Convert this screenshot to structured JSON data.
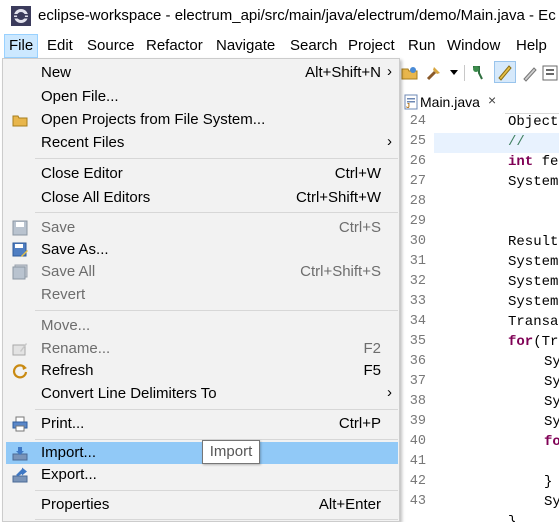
{
  "window": {
    "title": "eclipse-workspace - electrum_api/src/main/java/electrum/demo/Main.java - Ec"
  },
  "menubar": {
    "items": [
      {
        "label": "File"
      },
      {
        "label": "Edit"
      },
      {
        "label": "Source"
      },
      {
        "label": "Refactor"
      },
      {
        "label": "Navigate"
      },
      {
        "label": "Search"
      },
      {
        "label": "Project"
      },
      {
        "label": "Run"
      },
      {
        "label": "Window"
      },
      {
        "label": "Help"
      }
    ]
  },
  "file_menu": {
    "items": [
      {
        "label": "New",
        "shortcut": "Alt+Shift+N",
        "submenu": true
      },
      {
        "label": "Open File...",
        "shortcut": ""
      },
      {
        "label": "Open Projects from File System...",
        "shortcut": "",
        "icon": "folder-icon"
      },
      {
        "label": "Recent Files",
        "shortcut": "",
        "submenu": true
      },
      {
        "label": "Close Editor",
        "shortcut": "Ctrl+W"
      },
      {
        "label": "Close All Editors",
        "shortcut": "Ctrl+Shift+W"
      },
      {
        "label": "Save",
        "shortcut": "Ctrl+S",
        "disabled": true,
        "icon": "save-icon"
      },
      {
        "label": "Save As...",
        "shortcut": "",
        "icon": "save-as-icon"
      },
      {
        "label": "Save All",
        "shortcut": "Ctrl+Shift+S",
        "disabled": true,
        "icon": "save-all-icon"
      },
      {
        "label": "Revert",
        "shortcut": "",
        "disabled": true
      },
      {
        "label": "Move...",
        "shortcut": "",
        "disabled": true
      },
      {
        "label": "Rename...",
        "shortcut": "F2",
        "disabled": true,
        "icon": "rename-icon"
      },
      {
        "label": "Refresh",
        "shortcut": "F5",
        "icon": "refresh-icon"
      },
      {
        "label": "Convert Line Delimiters To",
        "shortcut": "",
        "submenu": true
      },
      {
        "label": "Print...",
        "shortcut": "Ctrl+P",
        "icon": "print-icon"
      },
      {
        "label": "Import...",
        "shortcut": "",
        "icon": "import-icon",
        "hover": true
      },
      {
        "label": "Export...",
        "shortcut": "",
        "icon": "export-icon"
      },
      {
        "label": "Properties",
        "shortcut": "Alt+Enter"
      }
    ],
    "submenu_arrow": "›"
  },
  "tooltip": {
    "text": "Import"
  },
  "editor": {
    "tab_label": "Main.java",
    "tab_close": "×",
    "line_numbers": [
      "24",
      "25",
      "26",
      "27",
      "28",
      "29",
      "30",
      "31",
      "32",
      "33",
      "34",
      "35",
      "36",
      "37",
      "38",
      "39",
      "40",
      "41",
      "42",
      "43"
    ],
    "code": {
      "l24": "Object",
      "l25": "//",
      "l26_kw": "int",
      "l26": " fe",
      "l27": "System",
      "l30": "Result",
      "l31": "System",
      "l32": "System",
      "l33": "System",
      "l34": "Transa",
      "l35_kw": "for",
      "l35": "(Tr",
      "l36": "Sy",
      "l37": "Sy",
      "l38": "Sy",
      "l39": "Sy",
      "l40_kw": "fo",
      "l42": "}",
      "l43": "Sy",
      "l44": "}"
    }
  },
  "colors": {
    "menu_hover": "#91c9f7",
    "menubar_active": "#cce8ff",
    "keyword": "#7f0055",
    "comment": "#3f7f5f"
  }
}
